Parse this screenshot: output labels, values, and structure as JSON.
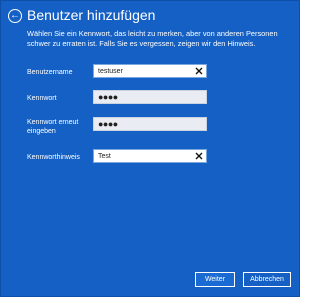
{
  "header": {
    "back_icon": "back-arrow-icon",
    "title": "Benutzer hinzufügen",
    "description": "Wählen Sie ein Kennwort, das leicht zu merken, aber von anderen Personen schwer zu erraten ist. Falls Sie es vergessen, zeigen wir den Hinweis."
  },
  "form": {
    "username": {
      "label": "Benutzername",
      "value": "testuser"
    },
    "password": {
      "label": "Kennwort",
      "value": "●●●●"
    },
    "password_confirm": {
      "label": "Kennwort erneut eingeben",
      "value": "●●●●"
    },
    "hint": {
      "label": "Kennworthinweis",
      "value": "Test"
    }
  },
  "buttons": {
    "next_label": "Weiter",
    "cancel_label": "Abbrechen"
  },
  "colors": {
    "background": "#1560c4",
    "field_bg": "#e9edf3",
    "text": "#ffffff"
  }
}
